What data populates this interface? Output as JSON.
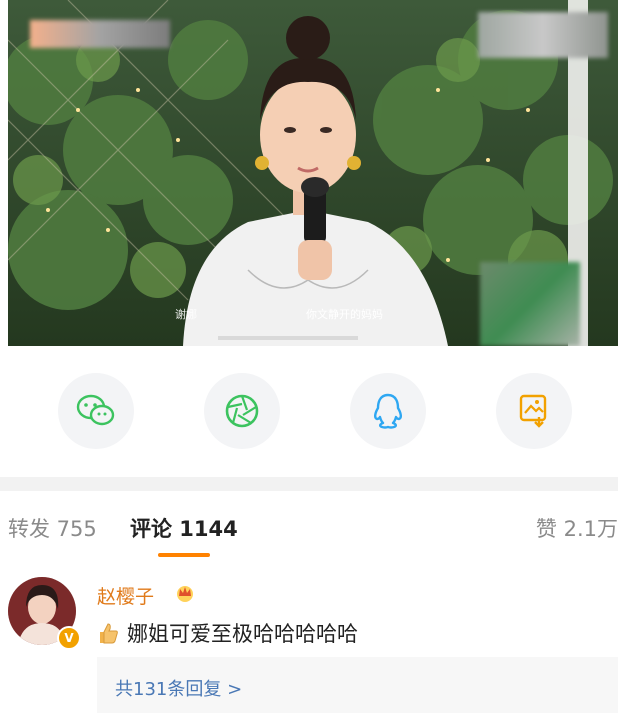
{
  "media": {
    "subtitle_left": "谢娜",
    "subtitle_right": "你文静开的妈妈"
  },
  "share": [
    {
      "name": "wechat",
      "icon": "wechat-icon",
      "color": "#3cc35f"
    },
    {
      "name": "moments",
      "icon": "moments-icon",
      "color": "#3cc35f"
    },
    {
      "name": "qq",
      "icon": "qq-icon",
      "color": "#2ea7f2"
    },
    {
      "name": "save-image",
      "icon": "save-image-icon",
      "color": "#f2a100"
    }
  ],
  "tabs": {
    "repost": "转发 755",
    "comment": "评论 1144",
    "like": "赞 2.1万"
  },
  "comment": {
    "username": "赵樱子",
    "text": "娜姐可爱至极哈哈哈哈哈",
    "reply_link": "共131条回复 >",
    "verified_badge": "V"
  },
  "colors": {
    "accent": "#ff8200",
    "username": "#e07a1a",
    "link": "#4a78b5"
  }
}
